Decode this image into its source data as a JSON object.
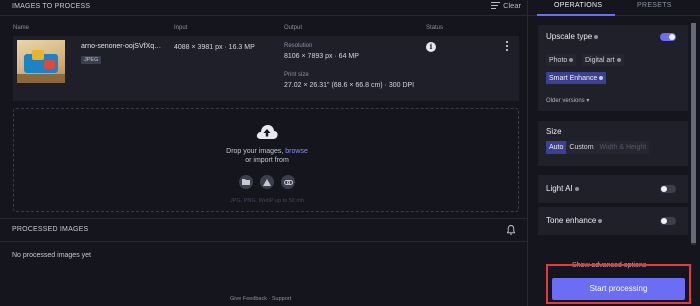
{
  "left": {
    "header": "IMAGES TO PROCESS",
    "clear_label": "Clear",
    "columns": {
      "input": "Input",
      "output": "Output",
      "status": "Status"
    },
    "image": {
      "filename": "arno-senoner-oojSVfXq…",
      "badge": "JPEG",
      "input_dims": "4088 × 3981 px · 16.3 MP",
      "resolution_label": "Resolution",
      "resolution_value": "8106 × 7893 px · 64 MP",
      "print_label": "Print size",
      "print_value": "27.02 × 26.31\" (68.6 × 66.8 cm) · 300 DPI"
    },
    "drop": {
      "line1_prefix": "Drop your images, ",
      "browse": "browse",
      "line2": "or import from",
      "formats": "JPG, PNG, WebP up to 50 mb",
      "sources": [
        "folder-icon",
        "google-drive-icon",
        "link-icon"
      ]
    },
    "processed_header": "PROCESSED IMAGES",
    "no_processed": "No processed images yet",
    "footer": "Give Feedback  ·  Support"
  },
  "right": {
    "tabs": [
      "OPERATIONS",
      "PRESETS"
    ],
    "active_tab": "OPERATIONS",
    "upscale": {
      "title": "Upscale type",
      "enabled": true,
      "chips": [
        "Photo",
        "Digital art",
        "Smart Enhance"
      ],
      "selected": "Smart Enhance",
      "older": "Older versions"
    },
    "size": {
      "title": "Size",
      "options": [
        "Auto",
        "Custom",
        "Width & Height"
      ],
      "selected": "Auto"
    },
    "light_ai": {
      "title": "Light AI",
      "enabled": false
    },
    "tone": {
      "title": "Tone enhance",
      "enabled": false
    },
    "advanced": "Show advanced options",
    "start": "Start processing"
  },
  "colors": {
    "accent": "#6b6ef5",
    "highlight_border": "#e23a3f",
    "background": "#14151d"
  }
}
